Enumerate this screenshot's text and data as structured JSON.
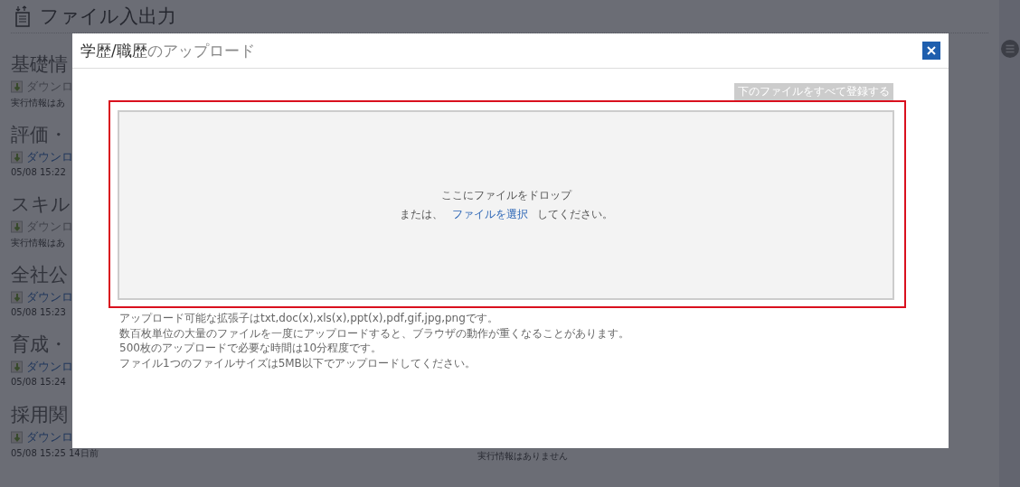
{
  "page": {
    "title": "ファイル入出力",
    "sections": [
      {
        "heading": "基礎情",
        "link": {
          "label": "ダウンロ",
          "disabled": true
        },
        "info": "実行情報はあ"
      },
      {
        "heading": "評価・",
        "link": {
          "label": "ダウンロ",
          "disabled": false
        },
        "info": "05/08 15:22"
      },
      {
        "heading": "スキル",
        "link": {
          "label": "ダウンロ",
          "disabled": true
        },
        "info": "実行情報はあ"
      },
      {
        "heading": "全社公",
        "link": {
          "label": "ダウンロ",
          "disabled": false
        },
        "info": "05/08 15:23"
      },
      {
        "heading": "育成・",
        "link": {
          "label": "ダウンロ",
          "disabled": false
        },
        "info": "05/08 15:24"
      },
      {
        "heading": "採用関",
        "link": {
          "label": "ダウンロ",
          "disabled": false
        },
        "info": "05/08 15:25 14日前"
      }
    ],
    "right_info": "実行情報はありません"
  },
  "dialog": {
    "title_subject": "学歴/職歴",
    "title_suffix": "のアップロード",
    "register_button": {
      "label": "下のファイルをすべて登録する",
      "disabled": true
    },
    "dropzone": {
      "line_1": "ここにファイルをドロップ",
      "prefix": "または、",
      "link": "ファイルを選択",
      "suffix": "してください。"
    },
    "notes": [
      "アップロード可能な拡張子はtxt,doc(x),xls(x),ppt(x),pdf,gif,jpg,pngです。",
      "数百枚単位の大量のファイルを一度にアップロードすると、ブラウザの動作が重くなることがあります。",
      "500枚のアップロードで必要な時間は10分程度です。",
      "ファイル1つのファイルサイズは5MB以下でアップロードしてください。"
    ]
  }
}
